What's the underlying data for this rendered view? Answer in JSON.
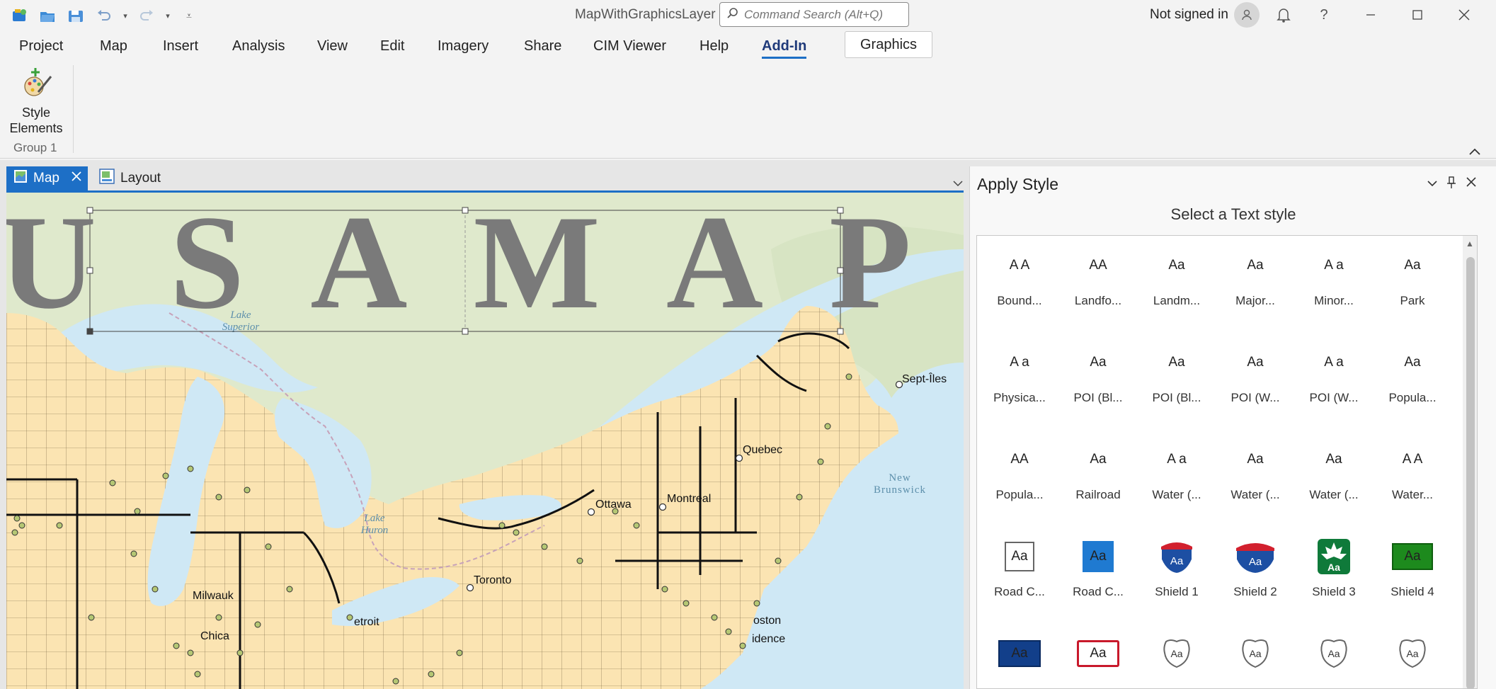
{
  "app": {
    "title": "MapWithGraphicsLayer",
    "search_placeholder": "Command Search (Alt+Q)",
    "signin": "Not signed in"
  },
  "quick_access": [
    "new-project-icon",
    "open-project-icon",
    "save-project-icon",
    "undo-icon",
    "undo-dropdown-icon",
    "redo-icon",
    "redo-dropdown-icon",
    "customize-qat-icon"
  ],
  "window_controls": [
    "notifications-icon",
    "help-icon",
    "minimize-icon",
    "maximize-icon",
    "close-icon"
  ],
  "ribbon": {
    "tabs": [
      "Project",
      "Map",
      "Insert",
      "Analysis",
      "View",
      "Edit",
      "Imagery",
      "Share",
      "CIM Viewer",
      "Help",
      "Add-In"
    ],
    "active_tab": "Add-In",
    "contextual_tab": "Graphics",
    "button_label_1": "Style",
    "button_label_2": "Elements",
    "group_label": "Group 1"
  },
  "doc_tabs": {
    "map": "Map",
    "layout": "Layout"
  },
  "map": {
    "graphic_text": "U S A   M A P",
    "water_labels": {
      "superior_1": "Lake",
      "superior_2": "Superior",
      "huron_1": "Lake",
      "huron_2": "Huron",
      "nb_1": "New",
      "nb_2": "Brunswick"
    },
    "cities": {
      "septiles": "Sept-Îles",
      "quebec": "Quebec",
      "ottawa": "Ottawa",
      "montreal": "Montreal",
      "toronto": "Toronto",
      "milwaukee": "Milwauk",
      "detroit": "etroit",
      "chicago": "Chica",
      "boston": "oston",
      "providence": "idence"
    }
  },
  "pane": {
    "title": "Apply Style",
    "subtitle": "Select a Text style",
    "styles": [
      {
        "name": "Bound...",
        "kind": "serif-gray",
        "text": "A A"
      },
      {
        "name": "Landfo...",
        "kind": "italic-gray",
        "text": "AA"
      },
      {
        "name": "Landm...",
        "kind": "small-gray",
        "text": "Aa"
      },
      {
        "name": "Major...",
        "kind": "bold-dark",
        "text": "Aa"
      },
      {
        "name": "Minor...",
        "kind": "small-gray",
        "text": "A a"
      },
      {
        "name": "Park",
        "kind": "light-gray",
        "text": "Aa"
      },
      {
        "name": "Physica...",
        "kind": "physical",
        "text": "A  a"
      },
      {
        "name": "POI (Bl...",
        "kind": "halo",
        "text": "Aa"
      },
      {
        "name": "POI (Bl...",
        "kind": "halo-light",
        "text": "Aa"
      },
      {
        "name": "POI (W...",
        "kind": "small-dark",
        "text": "Aa"
      },
      {
        "name": "POI (W...",
        "kind": "small-dark",
        "text": "A a"
      },
      {
        "name": "Popula...",
        "kind": "serif-bold",
        "text": "Aa"
      },
      {
        "name": "Popula...",
        "kind": "bold-big",
        "text": "AA"
      },
      {
        "name": "Railroad",
        "kind": "small-gray2",
        "text": "Aa"
      },
      {
        "name": "Water (...",
        "kind": "water-italic",
        "text": "A  a"
      },
      {
        "name": "Water (...",
        "kind": "water",
        "text": "Aa"
      },
      {
        "name": "Water (...",
        "kind": "water-small",
        "text": "Aa"
      },
      {
        "name": "Water...",
        "kind": "outline",
        "text": "A  A"
      },
      {
        "name": "Road C...",
        "kind": "box-white",
        "text": "Aa"
      },
      {
        "name": "Road C...",
        "kind": "box-blue",
        "text": "Aa"
      },
      {
        "name": "Shield 1",
        "kind": "interstate",
        "text": "Aa"
      },
      {
        "name": "Shield 2",
        "kind": "interstate2",
        "text": "Aa"
      },
      {
        "name": "Shield 3",
        "kind": "maple",
        "text": "Aa"
      },
      {
        "name": "Shield 4",
        "kind": "box-green",
        "text": "Aa"
      },
      {
        "name": "",
        "kind": "box-navy",
        "text": "Aa"
      },
      {
        "name": "",
        "kind": "box-red",
        "text": "Aa"
      },
      {
        "name": "",
        "kind": "us-shield",
        "text": "Aa"
      },
      {
        "name": "",
        "kind": "us-shield",
        "text": "Aa"
      },
      {
        "name": "",
        "kind": "us-shield",
        "text": "Aa"
      },
      {
        "name": "",
        "kind": "us-shield",
        "text": "Aa"
      }
    ]
  },
  "colors": {
    "accent": "#1d6fc6",
    "land_us": "#fbe4b2",
    "land_can": "#dfe9cc",
    "water": "#cfe8f5",
    "graphic_text": "#7a7a7a"
  }
}
